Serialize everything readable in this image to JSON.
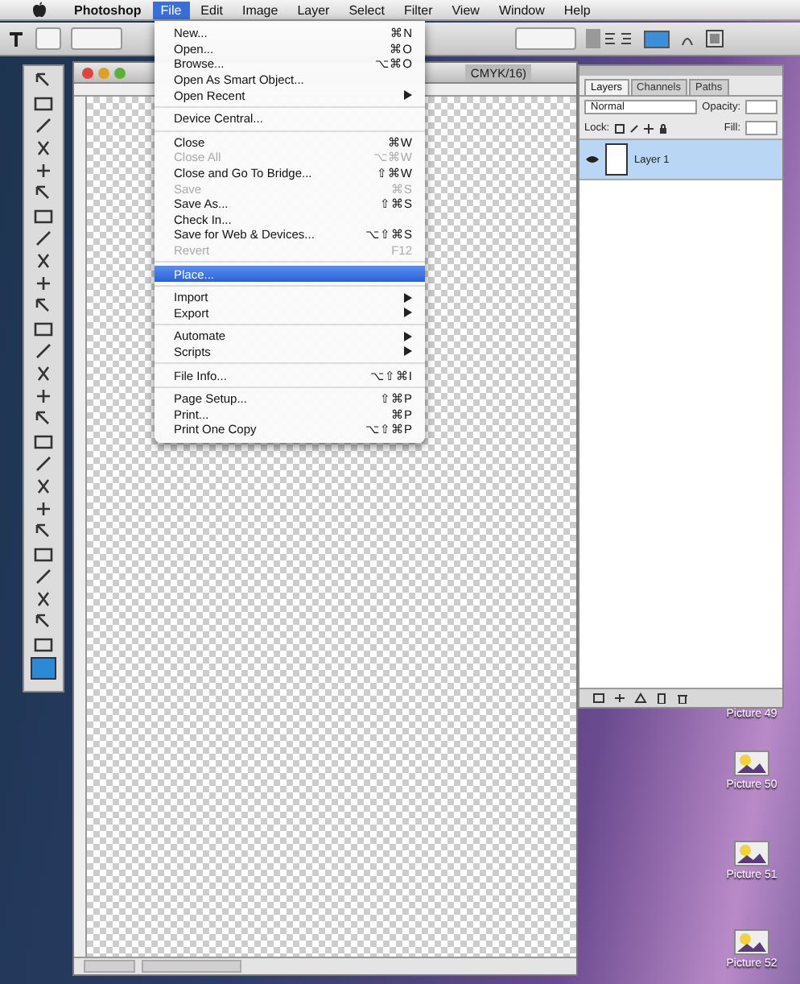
{
  "menu_bar": [
    {
      "label": "Photoshop",
      "selected": false,
      "bold": true
    },
    {
      "label": "File",
      "selected": true,
      "bold": false
    },
    {
      "label": "Edit",
      "selected": false,
      "bold": false
    },
    {
      "label": "Image",
      "selected": false,
      "bold": false
    },
    {
      "label": "Layer",
      "selected": false,
      "bold": false
    },
    {
      "label": "Select",
      "selected": false,
      "bold": false
    },
    {
      "label": "Filter",
      "selected": false,
      "bold": false
    },
    {
      "label": "View",
      "selected": false,
      "bold": false
    },
    {
      "label": "Window",
      "selected": false,
      "bold": false
    },
    {
      "label": "Help",
      "selected": false,
      "bold": false
    }
  ],
  "document": {
    "title": "CMYK/16)"
  },
  "file_menu": [
    {
      "kind": "item",
      "label": "New...",
      "shortcut": "⌘N",
      "submenu": false,
      "disabled": false,
      "selected": false
    },
    {
      "kind": "item",
      "label": "Open...",
      "shortcut": "⌘O",
      "submenu": false,
      "disabled": false,
      "selected": false
    },
    {
      "kind": "item",
      "label": "Browse...",
      "shortcut": "⌥⌘O",
      "submenu": false,
      "disabled": false,
      "selected": false
    },
    {
      "kind": "item",
      "label": "Open As Smart Object...",
      "submenu": false,
      "disabled": false,
      "selected": false
    },
    {
      "kind": "item",
      "label": "Open Recent",
      "submenu": true,
      "disabled": false,
      "selected": false
    },
    {
      "kind": "separator"
    },
    {
      "kind": "item",
      "label": "Device Central...",
      "submenu": false,
      "disabled": false,
      "selected": false
    },
    {
      "kind": "separator"
    },
    {
      "kind": "item",
      "label": "Close",
      "shortcut": "⌘W",
      "submenu": false,
      "disabled": false,
      "selected": false
    },
    {
      "kind": "item",
      "label": "Close All",
      "shortcut": "⌥⌘W",
      "submenu": false,
      "disabled": true,
      "selected": false
    },
    {
      "kind": "item",
      "label": "Close and Go To Bridge...",
      "shortcut": "⇧⌘W",
      "submenu": false,
      "disabled": false,
      "selected": false
    },
    {
      "kind": "item",
      "label": "Save",
      "shortcut": "⌘S",
      "submenu": false,
      "disabled": true,
      "selected": false
    },
    {
      "kind": "item",
      "label": "Save As...",
      "shortcut": "⇧⌘S",
      "submenu": false,
      "disabled": false,
      "selected": false
    },
    {
      "kind": "item",
      "label": "Check In...",
      "submenu": false,
      "disabled": false,
      "selected": false
    },
    {
      "kind": "item",
      "label": "Save for Web & Devices...",
      "shortcut": "⌥⇧⌘S",
      "submenu": false,
      "disabled": false,
      "selected": false
    },
    {
      "kind": "item",
      "label": "Revert",
      "shortcut": "F12",
      "submenu": false,
      "disabled": true,
      "selected": false
    },
    {
      "kind": "separator"
    },
    {
      "kind": "item",
      "label": "Place...",
      "submenu": false,
      "disabled": false,
      "selected": true
    },
    {
      "kind": "separator"
    },
    {
      "kind": "item",
      "label": "Import",
      "submenu": true,
      "disabled": false,
      "selected": false
    },
    {
      "kind": "item",
      "label": "Export",
      "submenu": true,
      "disabled": false,
      "selected": false
    },
    {
      "kind": "separator"
    },
    {
      "kind": "item",
      "label": "Automate",
      "submenu": true,
      "disabled": false,
      "selected": false
    },
    {
      "kind": "item",
      "label": "Scripts",
      "submenu": true,
      "disabled": false,
      "selected": false
    },
    {
      "kind": "separator"
    },
    {
      "kind": "item",
      "label": "File Info...",
      "shortcut": "⌥⇧⌘I",
      "submenu": false,
      "disabled": false,
      "selected": false
    },
    {
      "kind": "separator"
    },
    {
      "kind": "item",
      "label": "Page Setup...",
      "shortcut": "⇧⌘P",
      "submenu": false,
      "disabled": false,
      "selected": false
    },
    {
      "kind": "item",
      "label": "Print...",
      "shortcut": "⌘P",
      "submenu": false,
      "disabled": false,
      "selected": false
    },
    {
      "kind": "item",
      "label": "Print One Copy",
      "shortcut": "⌥⇧⌘P",
      "submenu": false,
      "disabled": false,
      "selected": false
    }
  ],
  "layers_panel": {
    "tabs": [
      {
        "label": "Layers",
        "selected": true
      },
      {
        "label": "Channels",
        "selected": false
      },
      {
        "label": "Paths",
        "selected": false
      }
    ],
    "blend_mode": "Normal",
    "opacity_label": "Opacity:",
    "lock_label": "Lock:",
    "fill_label": "Fill:",
    "layers": [
      {
        "name": "Layer 1",
        "selected": true,
        "visible": true
      }
    ]
  },
  "desktop_icons": [
    {
      "label": "Picture 49"
    },
    {
      "label": "Picture 50"
    },
    {
      "label": "Picture 51"
    },
    {
      "label": "Picture 52"
    }
  ]
}
